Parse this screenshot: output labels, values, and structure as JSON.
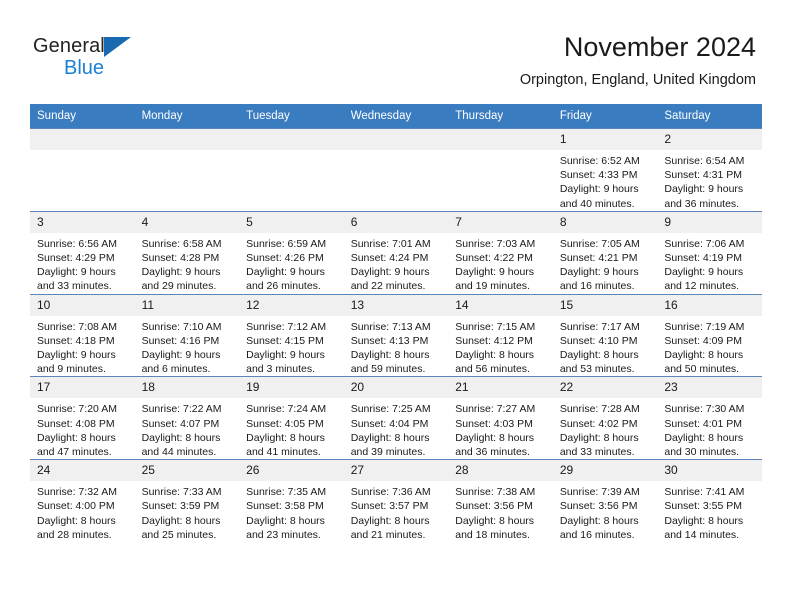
{
  "brand": {
    "name_part1": "General",
    "name_part2": "Blue",
    "triangle_color": "#1769b0",
    "blue_color": "#1b7fd4"
  },
  "header": {
    "title": "November 2024",
    "subtitle": "Orpington, England, United Kingdom"
  },
  "theme": {
    "header_row_bg": "#3a7cc0",
    "day_number_bg": "#f0f0f0",
    "grid_line": "#5a87b8"
  },
  "weekdays": [
    "Sunday",
    "Monday",
    "Tuesday",
    "Wednesday",
    "Thursday",
    "Friday",
    "Saturday"
  ],
  "weeks": [
    [
      {
        "day": "",
        "lines": []
      },
      {
        "day": "",
        "lines": []
      },
      {
        "day": "",
        "lines": []
      },
      {
        "day": "",
        "lines": []
      },
      {
        "day": "",
        "lines": []
      },
      {
        "day": "1",
        "lines": [
          "Sunrise: 6:52 AM",
          "Sunset: 4:33 PM",
          "Daylight: 9 hours",
          "and 40 minutes."
        ]
      },
      {
        "day": "2",
        "lines": [
          "Sunrise: 6:54 AM",
          "Sunset: 4:31 PM",
          "Daylight: 9 hours",
          "and 36 minutes."
        ]
      }
    ],
    [
      {
        "day": "3",
        "lines": [
          "Sunrise: 6:56 AM",
          "Sunset: 4:29 PM",
          "Daylight: 9 hours",
          "and 33 minutes."
        ]
      },
      {
        "day": "4",
        "lines": [
          "Sunrise: 6:58 AM",
          "Sunset: 4:28 PM",
          "Daylight: 9 hours",
          "and 29 minutes."
        ]
      },
      {
        "day": "5",
        "lines": [
          "Sunrise: 6:59 AM",
          "Sunset: 4:26 PM",
          "Daylight: 9 hours",
          "and 26 minutes."
        ]
      },
      {
        "day": "6",
        "lines": [
          "Sunrise: 7:01 AM",
          "Sunset: 4:24 PM",
          "Daylight: 9 hours",
          "and 22 minutes."
        ]
      },
      {
        "day": "7",
        "lines": [
          "Sunrise: 7:03 AM",
          "Sunset: 4:22 PM",
          "Daylight: 9 hours",
          "and 19 minutes."
        ]
      },
      {
        "day": "8",
        "lines": [
          "Sunrise: 7:05 AM",
          "Sunset: 4:21 PM",
          "Daylight: 9 hours",
          "and 16 minutes."
        ]
      },
      {
        "day": "9",
        "lines": [
          "Sunrise: 7:06 AM",
          "Sunset: 4:19 PM",
          "Daylight: 9 hours",
          "and 12 minutes."
        ]
      }
    ],
    [
      {
        "day": "10",
        "lines": [
          "Sunrise: 7:08 AM",
          "Sunset: 4:18 PM",
          "Daylight: 9 hours",
          "and 9 minutes."
        ]
      },
      {
        "day": "11",
        "lines": [
          "Sunrise: 7:10 AM",
          "Sunset: 4:16 PM",
          "Daylight: 9 hours",
          "and 6 minutes."
        ]
      },
      {
        "day": "12",
        "lines": [
          "Sunrise: 7:12 AM",
          "Sunset: 4:15 PM",
          "Daylight: 9 hours",
          "and 3 minutes."
        ]
      },
      {
        "day": "13",
        "lines": [
          "Sunrise: 7:13 AM",
          "Sunset: 4:13 PM",
          "Daylight: 8 hours",
          "and 59 minutes."
        ]
      },
      {
        "day": "14",
        "lines": [
          "Sunrise: 7:15 AM",
          "Sunset: 4:12 PM",
          "Daylight: 8 hours",
          "and 56 minutes."
        ]
      },
      {
        "day": "15",
        "lines": [
          "Sunrise: 7:17 AM",
          "Sunset: 4:10 PM",
          "Daylight: 8 hours",
          "and 53 minutes."
        ]
      },
      {
        "day": "16",
        "lines": [
          "Sunrise: 7:19 AM",
          "Sunset: 4:09 PM",
          "Daylight: 8 hours",
          "and 50 minutes."
        ]
      }
    ],
    [
      {
        "day": "17",
        "lines": [
          "Sunrise: 7:20 AM",
          "Sunset: 4:08 PM",
          "Daylight: 8 hours",
          "and 47 minutes."
        ]
      },
      {
        "day": "18",
        "lines": [
          "Sunrise: 7:22 AM",
          "Sunset: 4:07 PM",
          "Daylight: 8 hours",
          "and 44 minutes."
        ]
      },
      {
        "day": "19",
        "lines": [
          "Sunrise: 7:24 AM",
          "Sunset: 4:05 PM",
          "Daylight: 8 hours",
          "and 41 minutes."
        ]
      },
      {
        "day": "20",
        "lines": [
          "Sunrise: 7:25 AM",
          "Sunset: 4:04 PM",
          "Daylight: 8 hours",
          "and 39 minutes."
        ]
      },
      {
        "day": "21",
        "lines": [
          "Sunrise: 7:27 AM",
          "Sunset: 4:03 PM",
          "Daylight: 8 hours",
          "and 36 minutes."
        ]
      },
      {
        "day": "22",
        "lines": [
          "Sunrise: 7:28 AM",
          "Sunset: 4:02 PM",
          "Daylight: 8 hours",
          "and 33 minutes."
        ]
      },
      {
        "day": "23",
        "lines": [
          "Sunrise: 7:30 AM",
          "Sunset: 4:01 PM",
          "Daylight: 8 hours",
          "and 30 minutes."
        ]
      }
    ],
    [
      {
        "day": "24",
        "lines": [
          "Sunrise: 7:32 AM",
          "Sunset: 4:00 PM",
          "Daylight: 8 hours",
          "and 28 minutes."
        ]
      },
      {
        "day": "25",
        "lines": [
          "Sunrise: 7:33 AM",
          "Sunset: 3:59 PM",
          "Daylight: 8 hours",
          "and 25 minutes."
        ]
      },
      {
        "day": "26",
        "lines": [
          "Sunrise: 7:35 AM",
          "Sunset: 3:58 PM",
          "Daylight: 8 hours",
          "and 23 minutes."
        ]
      },
      {
        "day": "27",
        "lines": [
          "Sunrise: 7:36 AM",
          "Sunset: 3:57 PM",
          "Daylight: 8 hours",
          "and 21 minutes."
        ]
      },
      {
        "day": "28",
        "lines": [
          "Sunrise: 7:38 AM",
          "Sunset: 3:56 PM",
          "Daylight: 8 hours",
          "and 18 minutes."
        ]
      },
      {
        "day": "29",
        "lines": [
          "Sunrise: 7:39 AM",
          "Sunset: 3:56 PM",
          "Daylight: 8 hours",
          "and 16 minutes."
        ]
      },
      {
        "day": "30",
        "lines": [
          "Sunrise: 7:41 AM",
          "Sunset: 3:55 PM",
          "Daylight: 8 hours",
          "and 14 minutes."
        ]
      }
    ]
  ]
}
